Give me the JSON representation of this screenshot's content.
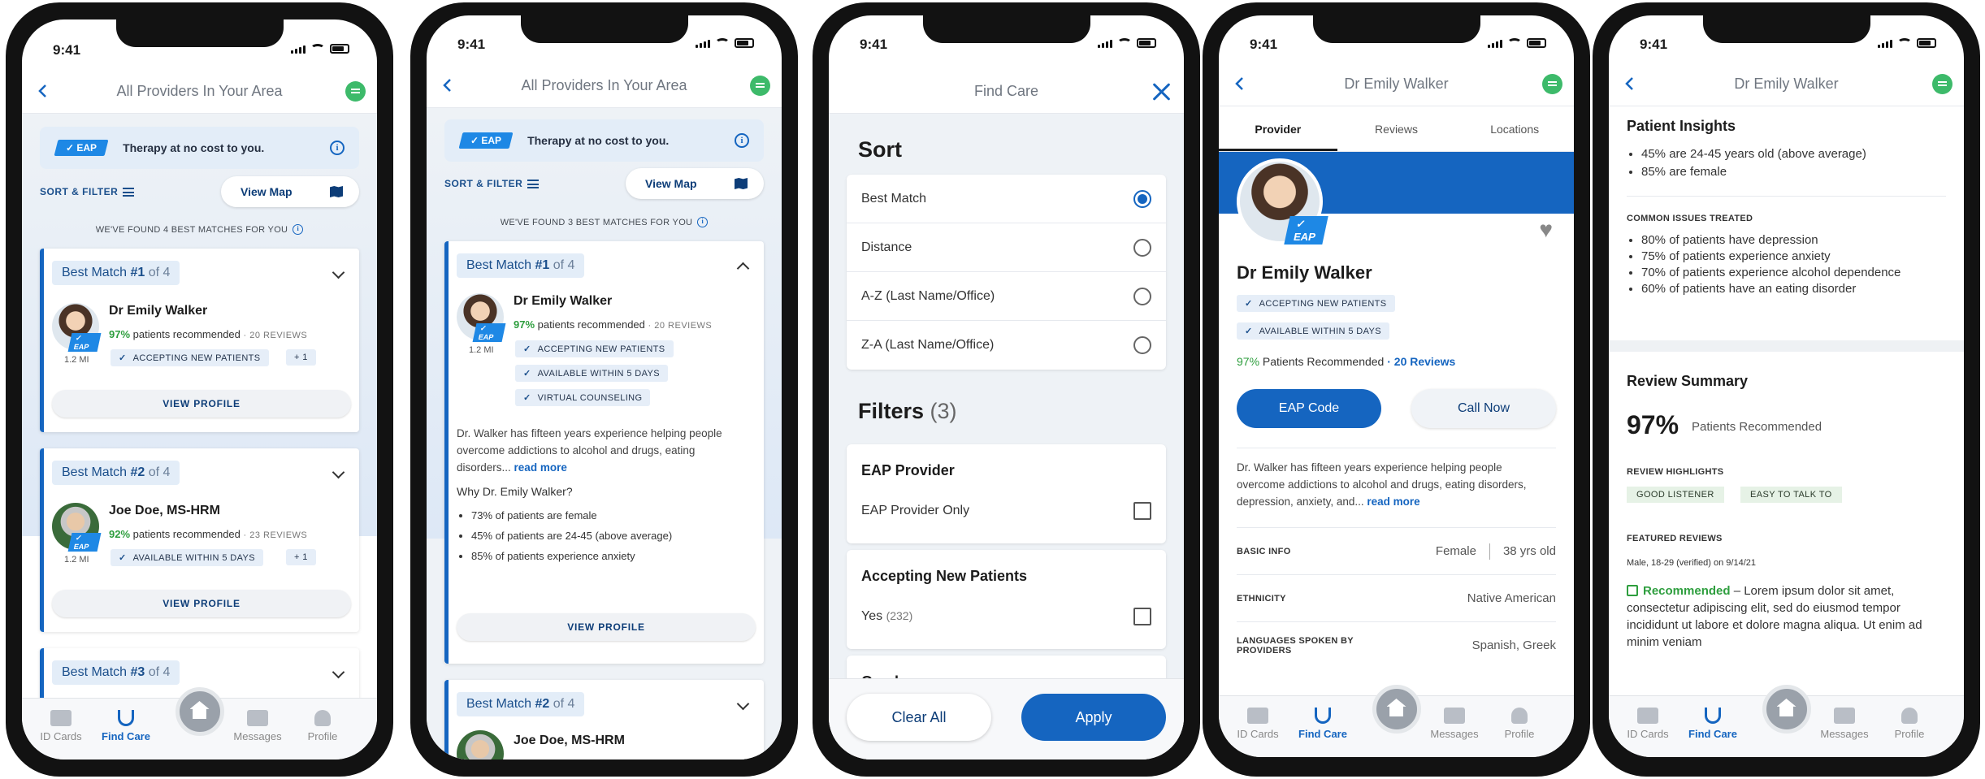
{
  "status": {
    "time": "9:41"
  },
  "tabs": {
    "id_cards": "ID Cards",
    "find_care": "Find Care",
    "messages": "Messages",
    "profile": "Profile"
  },
  "screen1": {
    "title": "All Providers In Your Area",
    "eap_badge": "✓ EAP",
    "eap_text": "Therapy at no cost to you.",
    "sort_filter": "SORT & FILTER",
    "view_map": "View Map",
    "found": "WE'VE FOUND 4 BEST MATCHES FOR YOU",
    "cards": [
      {
        "bm": "Best Match",
        "num": "#1",
        "of": "of 4",
        "name": "Dr Emily Walker",
        "pct": "97%",
        "pct_text": "patients recommended",
        "reviews": "· 20 REVIEWS",
        "dist": "1.2 MI",
        "tag": "ACCEPTING NEW PATIENTS",
        "more": "+ 1",
        "view": "VIEW PROFILE"
      },
      {
        "bm": "Best Match",
        "num": "#2",
        "of": "of 4",
        "name": "Joe Doe, MS-HRM",
        "pct": "92%",
        "pct_text": "patients recommended",
        "reviews": "· 23 REVIEWS",
        "dist": "1.2 MI",
        "tag": "AVAILABLE WITHIN 5 DAYS",
        "more": "+ 1",
        "view": "VIEW PROFILE"
      },
      {
        "bm": "Best Match",
        "num": "#3",
        "of": "of 4"
      }
    ]
  },
  "screen2": {
    "title": "All Providers In Your Area",
    "eap_badge": "✓ EAP",
    "eap_text": "Therapy at no cost to you.",
    "sort_filter": "SORT & FILTER",
    "view_map": "View Map",
    "found": "WE'VE FOUND 3 BEST MATCHES FOR YOU",
    "card": {
      "bm": "Best Match",
      "num": "#1",
      "of": "of 4",
      "name": "Dr Emily Walker",
      "pct": "97%",
      "pct_text": "patients recommended",
      "reviews": "· 20 REVIEWS",
      "dist": "1.2 MI",
      "tags": [
        "ACCEPTING NEW PATIENTS",
        "AVAILABLE WITHIN 5 DAYS",
        "VIRTUAL COUNSELING"
      ],
      "desc": "Dr. Walker has fifteen years experience helping people overcome addictions to alcohol and drugs, eating disorders...",
      "read_more": "read more",
      "why": "Why Dr. Emily Walker?",
      "bullets": [
        "73% of patients are female",
        "45% of patients are 24-45 (above average)",
        "85% of patients experience anxiety"
      ],
      "view": "VIEW PROFILE"
    },
    "card2": {
      "bm": "Best Match",
      "num": "#2",
      "of": "of 4",
      "name": "Joe Doe, MS-HRM"
    }
  },
  "screen3": {
    "title": "Find Care",
    "sort": "Sort",
    "sort_options": [
      "Best Match",
      "Distance",
      "A-Z (Last Name/Office)",
      "Z-A (Last Name/Office)"
    ],
    "filters": "Filters",
    "filters_count": "(3)",
    "eap_provider": "EAP Provider",
    "eap_only": "EAP Provider Only",
    "accepting": "Accepting New Patients",
    "yes": "Yes",
    "yes_count": "(232)",
    "gender_partial": "Gender",
    "clear": "Clear All",
    "apply": "Apply"
  },
  "screen4": {
    "title": "Dr Emily Walker",
    "tabs": [
      "Provider",
      "Reviews",
      "Locations"
    ],
    "eap_badge": "✓ EAP",
    "name": "Dr Emily Walker",
    "tags": [
      "ACCEPTING NEW PATIENTS",
      "AVAILABLE WITHIN 5 DAYS"
    ],
    "pct": "97%",
    "pct_text": "Patients Recommended",
    "reviews": "· 20 Reviews",
    "eap_code": "EAP Code",
    "call_now": "Call Now",
    "desc": "Dr. Walker has fifteen years experience helping people overcome addictions to alcohol and drugs, eating disorders, depression, anxiety, and...",
    "read_more": "read more",
    "basic_label": "BASIC INFO",
    "gender": "Female",
    "age": "38 yrs old",
    "eth_label": "ETHNICITY",
    "ethnicity": "Native American",
    "lang_label": "LANGUAGES SPOKEN BY PROVIDERS",
    "languages": "Spanish, Greek"
  },
  "screen5": {
    "title": "Dr Emily Walker",
    "insights": "Patient Insights",
    "insight_bullets": [
      "45% are 24-45 years old (above average)",
      "85% are female"
    ],
    "common": "COMMON ISSUES TREATED",
    "common_bullets": [
      "80% of patients have depression",
      "75% of patients experience anxiety",
      "70% of patients experience alcohol dependence",
      "60% of patients have an eating disorder"
    ],
    "review_summary": "Review Summary",
    "pct": "97%",
    "pct_text": "Patients Recommended",
    "highlights": "REVIEW HIGHLIGHTS",
    "highlight_tags": [
      "GOOD LISTENER",
      "EASY TO TALK TO"
    ],
    "featured": "FEATURED REVIEWS",
    "reviewer": "Male, 18-29 (verified) on 9/14/21",
    "recommended": "Recommended",
    "review_text": "– Lorem ipsum dolor sit amet, consectetur adipiscing elit, sed do eiusmod tempor incididunt ut labore et dolore magna aliqua. Ut enim ad minim veniam"
  },
  "colors": {
    "accent": "#1565c0",
    "positive": "#2e9e3e",
    "eap": "#1e88e5"
  }
}
